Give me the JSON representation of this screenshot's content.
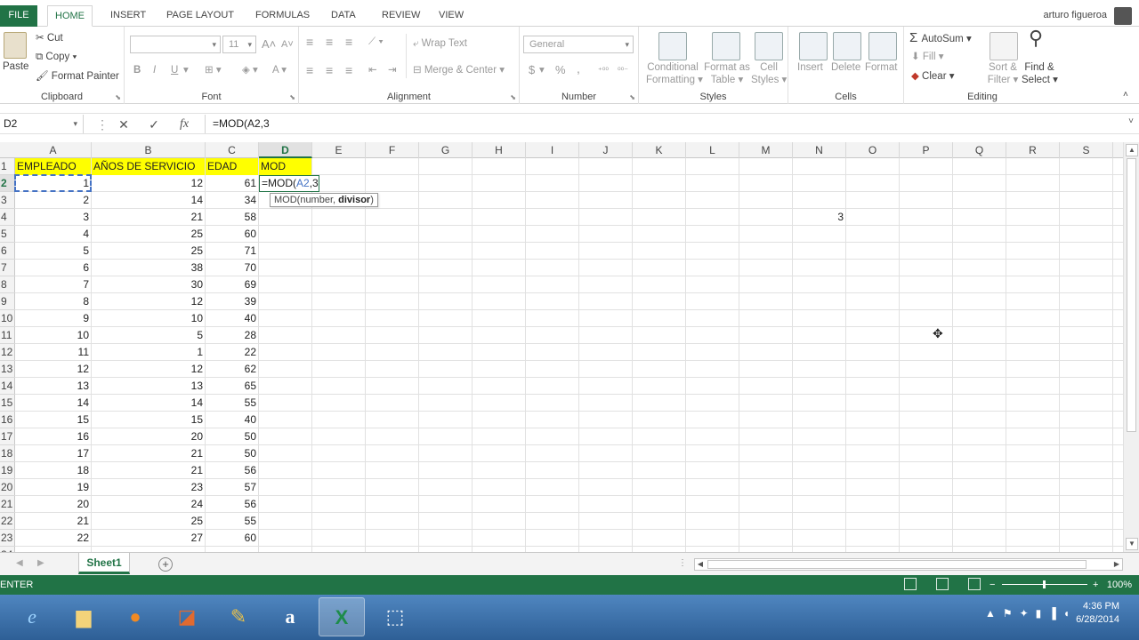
{
  "ribbon_tabs": [
    "FILE",
    "HOME",
    "INSERT",
    "PAGE LAYOUT",
    "FORMULAS",
    "DATA",
    "REVIEW",
    "VIEW"
  ],
  "user_name": "arturo figueroa",
  "clipboard": {
    "paste": "Paste",
    "cut": "Cut",
    "copy": "Copy",
    "format_painter": "Format Painter",
    "label": "Clipboard"
  },
  "font": {
    "size": "11",
    "label": "Font",
    "bold": "B",
    "italic": "I",
    "underline": "U",
    "font_color": "A"
  },
  "alignment": {
    "wrap": "Wrap Text",
    "merge": "Merge & Center",
    "label": "Alignment"
  },
  "number": {
    "format": "General",
    "currency": "$",
    "percent": "%",
    "comma": ",",
    "label": "Number"
  },
  "styles": {
    "conditional": [
      "Conditional",
      "Formatting"
    ],
    "format_table": [
      "Format as",
      "Table"
    ],
    "cell_styles": [
      "Cell",
      "Styles"
    ],
    "label": "Styles"
  },
  "cells": {
    "insert": "Insert",
    "delete": "Delete",
    "format": "Format",
    "label": "Cells"
  },
  "editing": {
    "autosum": "AutoSum",
    "fill": "Fill",
    "clear": "Clear",
    "sort": [
      "Sort &",
      "Filter"
    ],
    "find": [
      "Find &",
      "Select"
    ],
    "label": "Editing"
  },
  "formula_bar": {
    "name_box": "D2",
    "cancel": "✕",
    "enter": "✓",
    "fx": "fx",
    "formula": "=MOD(A2,3"
  },
  "columns": [
    "A",
    "B",
    "C",
    "D",
    "E",
    "F",
    "G",
    "H",
    "I",
    "J",
    "K",
    "L",
    "M",
    "N",
    "O",
    "P",
    "Q",
    "R",
    "S"
  ],
  "header_row": [
    "EMPLEADO",
    "AÑOS DE SERVICIO",
    "EDAD",
    "MOD"
  ],
  "rows": [
    [
      1,
      12,
      61
    ],
    [
      2,
      14,
      34
    ],
    [
      3,
      21,
      58
    ],
    [
      4,
      25,
      60
    ],
    [
      5,
      25,
      71
    ],
    [
      6,
      38,
      70
    ],
    [
      7,
      30,
      69
    ],
    [
      8,
      12,
      39
    ],
    [
      9,
      10,
      40
    ],
    [
      10,
      5,
      28
    ],
    [
      11,
      1,
      22
    ],
    [
      12,
      12,
      62
    ],
    [
      13,
      13,
      65
    ],
    [
      14,
      14,
      55
    ],
    [
      15,
      15,
      40
    ],
    [
      16,
      20,
      50
    ],
    [
      17,
      21,
      50
    ],
    [
      18,
      21,
      56
    ],
    [
      19,
      23,
      57
    ],
    [
      20,
      24,
      56
    ],
    [
      21,
      25,
      55
    ],
    [
      22,
      27,
      60
    ]
  ],
  "edit_cell": {
    "prefix": "=MOD(",
    "ref": "A2",
    "suffix": ",3"
  },
  "tooltip": {
    "fn": "MOD(number, ",
    "bold_arg": "divisor",
    ")": ")"
  },
  "cell_n4": "3",
  "sheet_tab": "Sheet1",
  "status": {
    "mode": "ENTER",
    "zoom": "100%"
  },
  "clock": {
    "time": "4:36 PM",
    "date": "6/28/2014"
  },
  "colors": {
    "accent": "#217346",
    "header_fill": "#ffff00",
    "ref": "#4472c4"
  }
}
